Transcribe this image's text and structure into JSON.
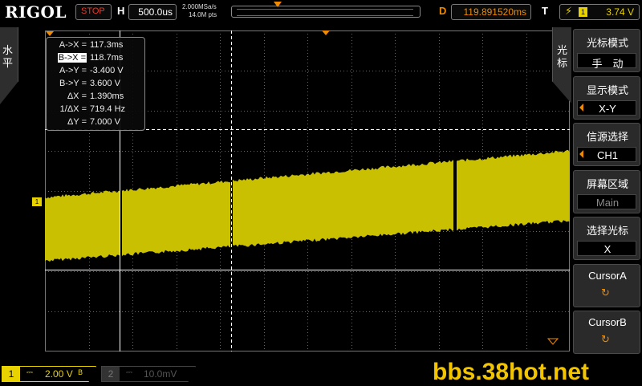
{
  "header": {
    "brand": "RIGOL",
    "run_state": "STOP",
    "timebase_label": "H",
    "timebase_value": "500.0us",
    "sample_rate": "2.000MSa/s",
    "memory_depth": "14.0M pts",
    "delay_label": "D",
    "delay_value": "119.891520ms",
    "trigger_label": "T",
    "trigger_source": "1",
    "trigger_level": "3.74 V",
    "colors": {
      "trigger_marker": "#f08a00",
      "run_state": "#e23c2c",
      "channel1": "#e8d200"
    }
  },
  "left_tab": {
    "label": "水平"
  },
  "channel_marker": {
    "label": "1"
  },
  "measurements": {
    "rows": [
      {
        "key": "A->X =",
        "value": "117.3ms"
      },
      {
        "key": "B->X =",
        "value": "118.7ms",
        "selected": true
      },
      {
        "key": "A->Y =",
        "value": "-3.400 V"
      },
      {
        "key": "B->Y =",
        "value": "3.600 V"
      },
      {
        "key": "ΔX =",
        "value": "1.390ms"
      },
      {
        "key": "1/ΔX =",
        "value": "719.4 Hz"
      },
      {
        "key": "ΔY =",
        "value": "7.000 V"
      }
    ]
  },
  "menu": {
    "tab_label": "光标",
    "items": [
      {
        "title": "光标模式",
        "value": "手　动",
        "arrow": false
      },
      {
        "title": "显示模式",
        "value": "X-Y",
        "arrow": true
      },
      {
        "title": "信源选择",
        "value": "CH1",
        "arrow": true
      },
      {
        "title": "屏幕区域",
        "value": "Main",
        "arrow": false,
        "dim": true
      },
      {
        "title": "选择光标",
        "value": "X",
        "arrow": false
      },
      {
        "title": "CursorA",
        "icon": "knob-icon"
      },
      {
        "title": "CursorB",
        "icon": "knob-icon"
      }
    ]
  },
  "footer": {
    "ch1": {
      "number": "1",
      "coupling": "⎓",
      "scale": "2.00 V",
      "bw": "B"
    },
    "ch2": {
      "number": "2",
      "coupling": "⎓",
      "scale": "10.0mV"
    },
    "watermark": "bbs.38hot.net"
  }
}
